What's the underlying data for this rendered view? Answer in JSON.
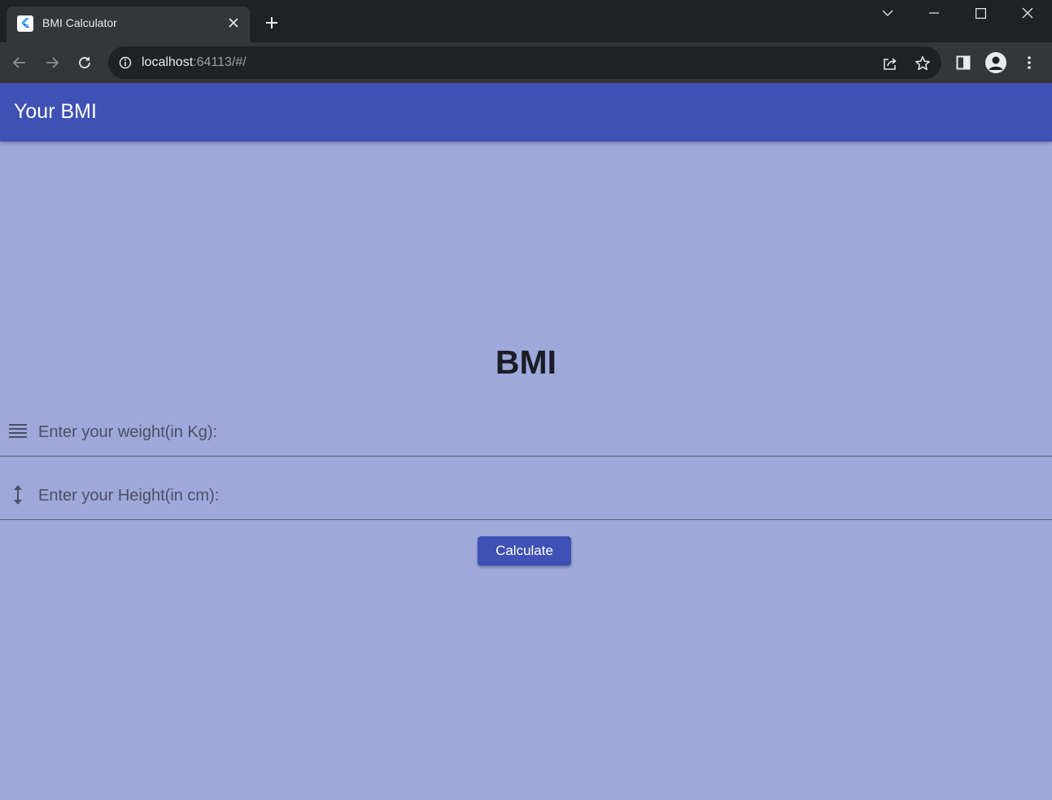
{
  "browser": {
    "tab": {
      "title": "BMI Calculator",
      "favicon": "flutter-logo-icon"
    },
    "address_bar": {
      "host": "localhost",
      "rest": ":64113/#/"
    },
    "icons": {
      "tab_close": "close-icon",
      "new_tab": "plus-icon",
      "tab_search": "chevron-down-icon",
      "minimize": "minimize-icon",
      "maximize": "maximize-icon",
      "close_window": "close-icon",
      "back": "back-arrow-icon",
      "forward": "forward-arrow-icon",
      "reload": "reload-icon",
      "site_info": "info-icon",
      "share": "share-icon",
      "bookmark": "star-icon",
      "side_panel": "side-panel-icon",
      "profile": "profile-avatar-icon",
      "menu": "kebab-menu-icon"
    }
  },
  "app": {
    "appbar_title": "Your BMI",
    "heading": "BMI",
    "weight_field": {
      "placeholder": "Enter your weight(in Kg):",
      "icon": "lines-icon"
    },
    "height_field": {
      "placeholder": "Enter your Height(in cm):",
      "icon": "vertical-resize-icon"
    },
    "calculate_label": "Calculate"
  },
  "colors": {
    "appbar": "#3f51b5",
    "background": "#9fa8da",
    "button": "#3f51b5",
    "chrome_dark": "#202124",
    "chrome_toolbar": "#35363a"
  }
}
